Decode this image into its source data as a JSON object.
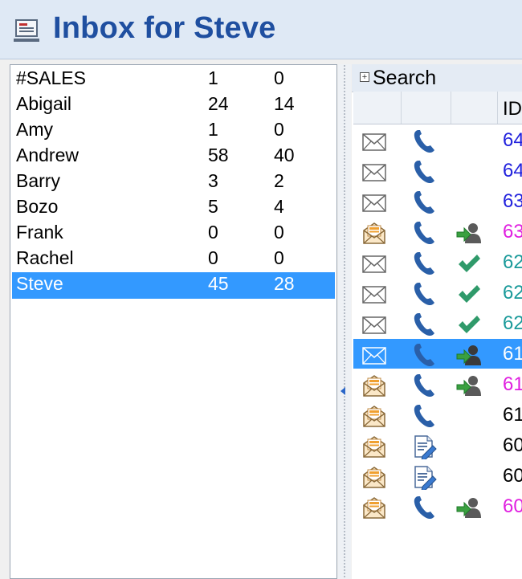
{
  "window": {
    "title": "Inbox for Steve",
    "icon": "inbox-window-icon"
  },
  "users": [
    {
      "name": "#SALES",
      "count1": "1",
      "count2": "0",
      "selected": false
    },
    {
      "name": "Abigail",
      "count1": "24",
      "count2": "14",
      "selected": false
    },
    {
      "name": "Amy",
      "count1": "1",
      "count2": "0",
      "selected": false
    },
    {
      "name": "Andrew",
      "count1": "58",
      "count2": "40",
      "selected": false
    },
    {
      "name": "Barry",
      "count1": "3",
      "count2": "2",
      "selected": false
    },
    {
      "name": "Bozo",
      "count1": "5",
      "count2": "4",
      "selected": false
    },
    {
      "name": "Frank",
      "count1": "0",
      "count2": "0",
      "selected": false
    },
    {
      "name": "Rachel",
      "count1": "0",
      "count2": "0",
      "selected": false
    },
    {
      "name": "Steve",
      "count1": "45",
      "count2": "28",
      "selected": true
    }
  ],
  "search": {
    "label": "Search",
    "expand_icon": "plus-icon"
  },
  "grid": {
    "columns": [
      "",
      "",
      "",
      "ID"
    ],
    "rows": [
      {
        "mail": "envelope-plain",
        "type": "phone",
        "status": "",
        "id": "64",
        "color": "#2222dd",
        "selected": false
      },
      {
        "mail": "envelope-plain",
        "type": "phone",
        "status": "",
        "id": "64",
        "color": "#2222dd",
        "selected": false
      },
      {
        "mail": "envelope-plain",
        "type": "phone",
        "status": "",
        "id": "63",
        "color": "#2222dd",
        "selected": false
      },
      {
        "mail": "envelope-open",
        "type": "phone",
        "status": "assign",
        "id": "63",
        "color": "#e020e0",
        "selected": false
      },
      {
        "mail": "envelope-plain",
        "type": "phone",
        "status": "check",
        "id": "62",
        "color": "#1a9a9a",
        "selected": false
      },
      {
        "mail": "envelope-plain",
        "type": "phone",
        "status": "check",
        "id": "62",
        "color": "#1a9a9a",
        "selected": false
      },
      {
        "mail": "envelope-plain",
        "type": "phone",
        "status": "check",
        "id": "62",
        "color": "#1a9a9a",
        "selected": false
      },
      {
        "mail": "envelope-plain",
        "type": "phone",
        "status": "assign",
        "id": "61",
        "color": "#ffffff",
        "selected": true
      },
      {
        "mail": "envelope-open",
        "type": "phone",
        "status": "assign",
        "id": "61",
        "color": "#e020e0",
        "selected": false
      },
      {
        "mail": "envelope-open",
        "type": "phone",
        "status": "",
        "id": "61",
        "color": "#000000",
        "selected": false
      },
      {
        "mail": "envelope-open",
        "type": "note",
        "status": "",
        "id": "60",
        "color": "#000000",
        "selected": false
      },
      {
        "mail": "envelope-open",
        "type": "note",
        "status": "",
        "id": "60",
        "color": "#000000",
        "selected": false
      },
      {
        "mail": "envelope-open",
        "type": "phone",
        "status": "assign",
        "id": "60",
        "color": "#e020e0",
        "selected": false
      }
    ]
  },
  "colors": {
    "selection": "#3399ff",
    "title_text": "#1f4fa0",
    "phone": "#2a5fa8",
    "check": "#2f9a6a"
  }
}
